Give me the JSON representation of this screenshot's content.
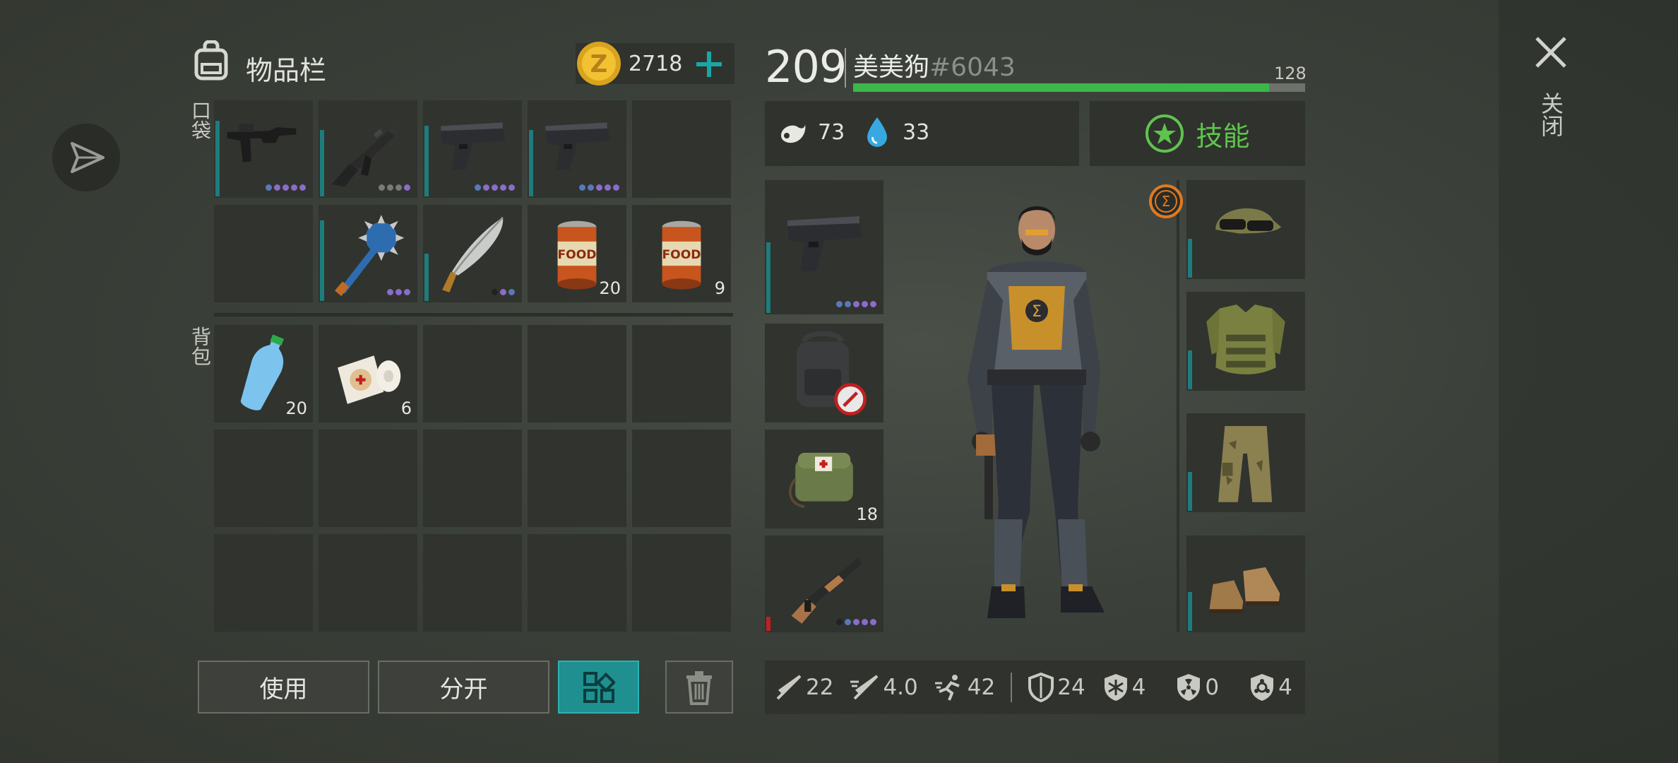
{
  "inventory": {
    "title": "物品栏",
    "pockets_label": "口袋",
    "backpack_label": "背包",
    "coins": "2718",
    "pockets": [
      {
        "icon": "uzi-icon",
        "count": "",
        "dots": [
          "b",
          "p",
          "p",
          "p",
          "p"
        ],
        "bar": 0.8
      },
      {
        "icon": "assault-rifle-icon",
        "count": "",
        "dots": [
          "g",
          "g",
          "g",
          "p"
        ],
        "bar": 0.7
      },
      {
        "icon": "pistol-icon",
        "count": "",
        "dots": [
          "b",
          "p",
          "p",
          "p",
          "p"
        ],
        "bar": 0.75
      },
      {
        "icon": "pistol-icon",
        "count": "",
        "dots": [
          "b",
          "b",
          "p",
          "p",
          "p"
        ],
        "bar": 0.7
      },
      {
        "icon": "empty",
        "count": "",
        "dots": [],
        "bar": 0
      },
      {
        "icon": "empty",
        "count": "",
        "dots": [],
        "bar": 0
      },
      {
        "icon": "spiked-mace-icon",
        "count": "",
        "dots": [
          "p",
          "p",
          "p"
        ],
        "bar": 0.85
      },
      {
        "icon": "machete-icon",
        "count": "",
        "dots": [
          "k",
          "p",
          "b"
        ],
        "bar": 0.5
      },
      {
        "icon": "food-can-icon",
        "count": "20",
        "dots": [],
        "bar": 0
      },
      {
        "icon": "food-can-icon",
        "count": "9",
        "dots": [],
        "bar": 0
      }
    ],
    "backpack": [
      {
        "icon": "water-bottle-icon",
        "count": "20"
      },
      {
        "icon": "bandage-icon",
        "count": "6"
      },
      {
        "icon": "empty",
        "count": ""
      },
      {
        "icon": "empty",
        "count": ""
      },
      {
        "icon": "empty",
        "count": ""
      },
      {
        "icon": "empty",
        "count": ""
      },
      {
        "icon": "empty",
        "count": ""
      },
      {
        "icon": "empty",
        "count": ""
      },
      {
        "icon": "empty",
        "count": ""
      },
      {
        "icon": "empty",
        "count": ""
      },
      {
        "icon": "empty",
        "count": ""
      },
      {
        "icon": "empty",
        "count": ""
      },
      {
        "icon": "empty",
        "count": ""
      },
      {
        "icon": "empty",
        "count": ""
      },
      {
        "icon": "empty",
        "count": ""
      }
    ],
    "buttons": {
      "use": "使用",
      "split": "分开"
    }
  },
  "character": {
    "level": "209",
    "name": "美美狗",
    "tag": "#6043",
    "xp_value": "128",
    "xp_fill": 0.92,
    "hunger": "73",
    "thirst": "33",
    "skills_label": "技能",
    "left_equipment": [
      {
        "icon": "pistol-icon",
        "count": "",
        "dots": [
          "b",
          "b",
          "p",
          "p",
          "p"
        ]
      },
      {
        "icon": "backpack-icon",
        "count": ""
      },
      {
        "icon": "medkit-bag-icon",
        "count": "18"
      },
      {
        "icon": "shotgun-icon",
        "count": "",
        "dots": [
          "k",
          "b",
          "p",
          "p",
          "p"
        ]
      }
    ],
    "right_equipment": [
      {
        "icon": "cap-goggles-icon"
      },
      {
        "icon": "armor-vest-icon"
      },
      {
        "icon": "camo-pants-icon"
      },
      {
        "icon": "boots-icon"
      }
    ]
  },
  "stats": {
    "melee": "22",
    "attack_speed": "4.0",
    "speed": "42",
    "armor": "24",
    "cold": "4",
    "radiation": "0",
    "infection": "4"
  },
  "close_label": "关闭",
  "colors": {
    "accent_teal": "#1aa6a6",
    "green": "#5fc44d",
    "xp_bar": "#3cb84a",
    "slot": "#30332e"
  }
}
